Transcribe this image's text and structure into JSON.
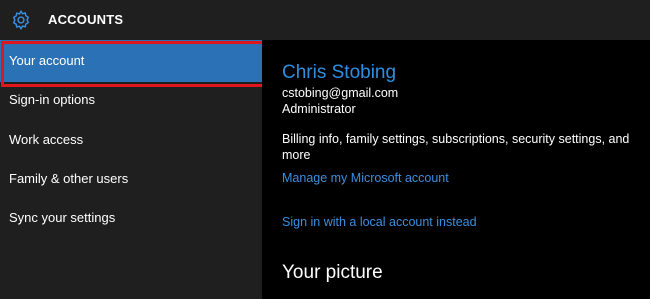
{
  "header": {
    "title": "ACCOUNTS",
    "icon": "gear-icon",
    "accent": "#3a8fe0"
  },
  "sidebar": {
    "items": [
      {
        "label": "Your account",
        "selected": true
      },
      {
        "label": "Sign-in options"
      },
      {
        "label": "Work access"
      },
      {
        "label": "Family & other users"
      },
      {
        "label": "Sync your settings"
      }
    ],
    "selected_bg": "#2b71b5",
    "highlight_border": "#e0161e"
  },
  "main": {
    "user_name": "Chris Stobing",
    "email": "cstobing@gmail.com",
    "role": "Administrator",
    "billing_text": "Billing info, family settings, subscriptions, security settings, and more",
    "manage_link": "Manage my Microsoft account",
    "local_link": "Sign in with a local account instead",
    "picture_heading": "Your picture"
  }
}
